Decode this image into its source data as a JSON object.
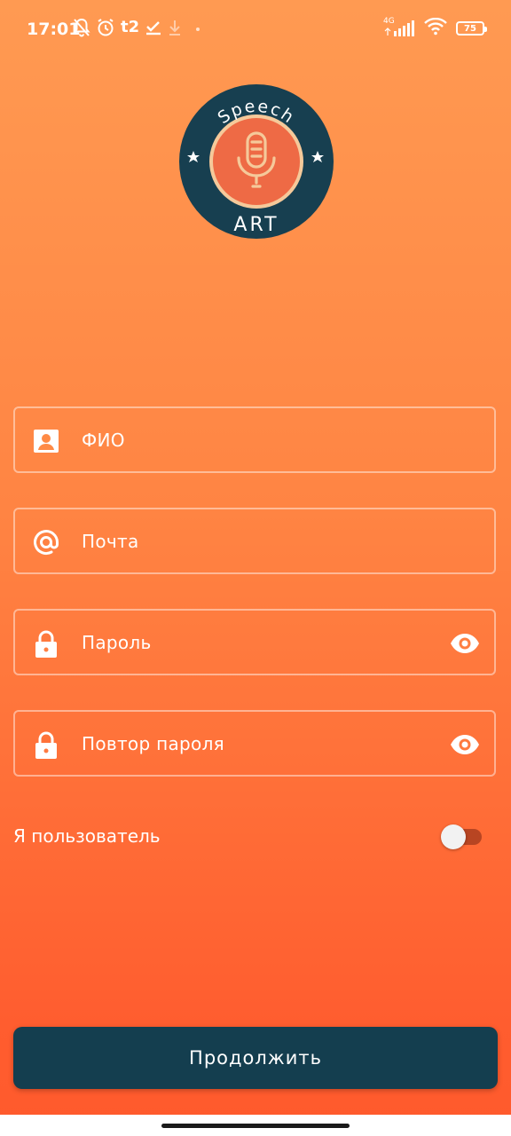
{
  "status_bar": {
    "time": "17:01",
    "carrier": "t2",
    "network": "4G",
    "battery": "75"
  },
  "logo": {
    "top_text": "Speech",
    "bottom_text": "ART",
    "colors": {
      "ring": "#173f50",
      "inner": "#ee6a45",
      "accent": "#f5c99a"
    }
  },
  "form": {
    "full_name_label": "ФИО",
    "email_label": "Почта",
    "password_label": "Пароль",
    "repeat_password_label": "Повтор пароля"
  },
  "user_toggle": {
    "label": "Я пользователь",
    "checked": false
  },
  "continue_button": {
    "label": "Продолжить"
  },
  "colors": {
    "button_bg": "#143e4f",
    "gradient_top": "#ff9a52",
    "gradient_bottom": "#ff5a2c"
  }
}
